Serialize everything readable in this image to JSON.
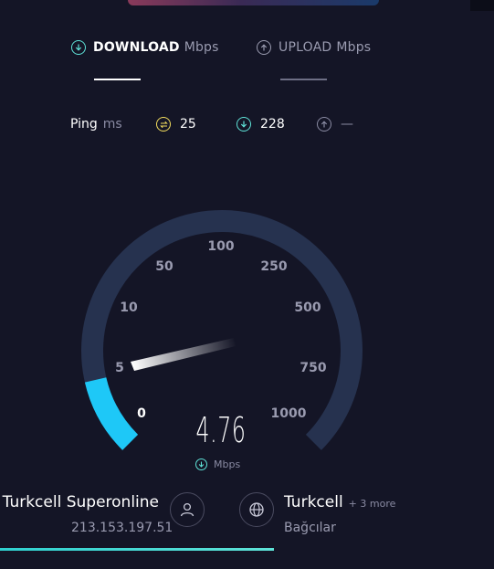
{
  "tabs": {
    "download": {
      "label": "DOWNLOAD",
      "unit": "Mbps"
    },
    "upload": {
      "label": "UPLOAD",
      "unit": "Mbps"
    }
  },
  "ping": {
    "label": "Ping",
    "unit": "ms",
    "idle": "25",
    "download": "228",
    "upload": "—"
  },
  "gauge": {
    "scale_labels": [
      "0",
      "5",
      "10",
      "50",
      "100",
      "250",
      "500",
      "750",
      "1000"
    ],
    "value": "4.76",
    "unit": "Mbps"
  },
  "isp": {
    "name": "Turkcell Superonline",
    "ip": "213.153.197.51"
  },
  "server": {
    "name": "Turkcell",
    "more": "+ 3 more",
    "location": "Bağcılar"
  },
  "colors": {
    "background": "#141526",
    "accent": "#5fe3d8",
    "gauge_fill": "#1ec8f7",
    "gauge_track": "#26324f",
    "ping_idle": "#f2dc5d"
  }
}
